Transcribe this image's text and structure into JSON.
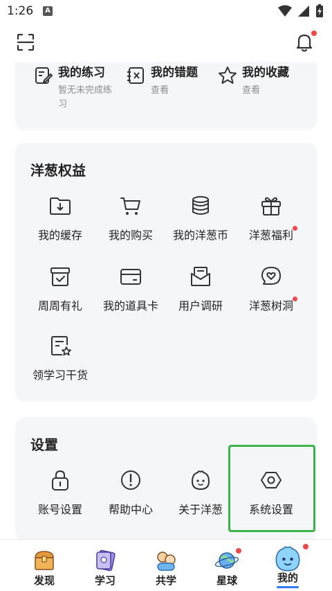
{
  "status_bar": {
    "time": "1:26",
    "notif_letter": "A"
  },
  "quick": [
    {
      "title": "我的练习",
      "subtitle": "暂无未完成练\n习"
    },
    {
      "title": "我的错题",
      "subtitle": "查看"
    },
    {
      "title": "我的收藏",
      "subtitle": "查看"
    }
  ],
  "rights": {
    "title": "洋葱权益",
    "items": [
      {
        "label": "我的缓存",
        "icon": "download-folder-icon"
      },
      {
        "label": "我的购买",
        "icon": "shopping-cart-icon"
      },
      {
        "label": "我的洋葱币",
        "icon": "coins-icon"
      },
      {
        "label": "洋葱福利",
        "icon": "gift-icon",
        "badge": true
      },
      {
        "label": "周周有礼",
        "icon": "gift-box-icon"
      },
      {
        "label": "我的道具卡",
        "icon": "card-icon"
      },
      {
        "label": "用户调研",
        "icon": "survey-icon"
      },
      {
        "label": "洋葱树洞",
        "icon": "heart-bubble-icon",
        "badge": true
      },
      {
        "label": "领学习干货",
        "icon": "star-document-icon"
      }
    ]
  },
  "settings": {
    "title": "设置",
    "items": [
      {
        "label": "账号设置",
        "icon": "lock-icon"
      },
      {
        "label": "帮助中心",
        "icon": "help-icon"
      },
      {
        "label": "关于洋葱",
        "icon": "onion-face-icon"
      },
      {
        "label": "系统设置",
        "icon": "settings-hex-icon"
      }
    ]
  },
  "tabs": [
    {
      "label": "发现",
      "icon": "treasure-chest-icon"
    },
    {
      "label": "学习",
      "icon": "book-icon"
    },
    {
      "label": "共学",
      "icon": "friends-icon"
    },
    {
      "label": "星球",
      "icon": "planet-icon",
      "badge": true
    },
    {
      "label": "我的",
      "icon": "onion-mascot-icon",
      "badge": true,
      "active": true
    }
  ],
  "colors": {
    "accent_blue": "#2f7bf5",
    "badge_red": "#f0484b",
    "highlight_green": "#3bb44a",
    "card_bg": "#f5f6f8"
  }
}
